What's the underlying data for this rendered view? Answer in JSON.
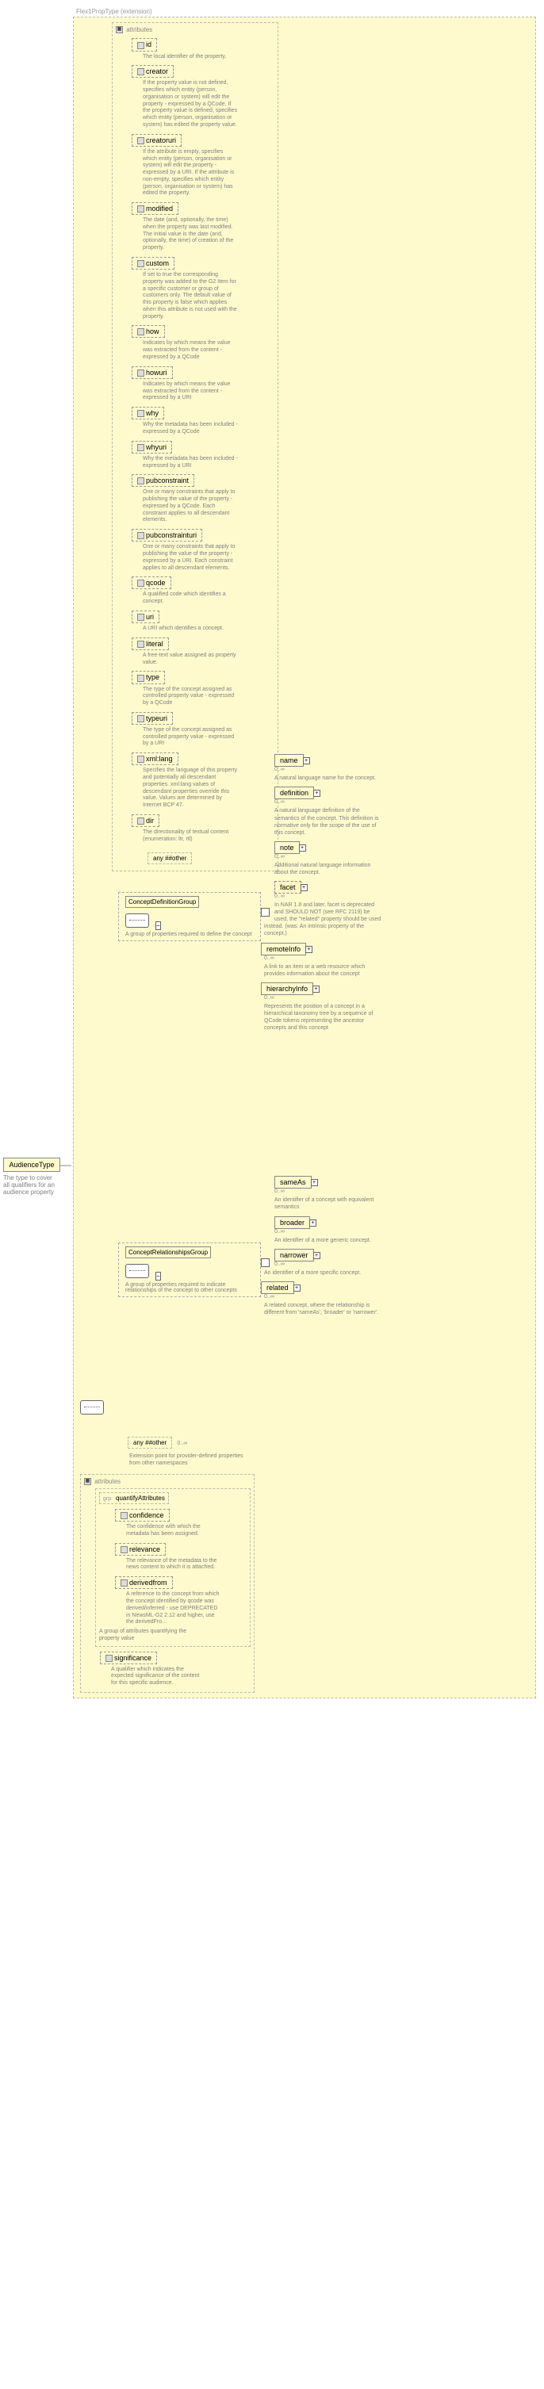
{
  "root": {
    "name": "AudienceType",
    "desc": "The type to cover all qualifiers for an audience property"
  },
  "extension": "Flex1PropType (extension)",
  "attrs_hdr": "attributes",
  "any": "any ##other",
  "flex_attrs": [
    {
      "n": "id",
      "d": "The local identifier of the property."
    },
    {
      "n": "creator",
      "d": "If the property value is not defined, specifies which entity (person, organisation or system) will edit the property - expressed by a QCode. If the property value is defined, specifies which entity (person, organisation or system) has edited the property value."
    },
    {
      "n": "creatoruri",
      "d": "If the attribute is empty, specifies which entity (person, organisation or system) will edit the property - expressed by a URI. If the attribute is non-empty, specifies which entity (person, organisation or system) has edited the property."
    },
    {
      "n": "modified",
      "d": "The date (and, optionally, the time) when the property was last modified. The initial value is the date (and, optionally, the time) of creation of the property."
    },
    {
      "n": "custom",
      "d": "If set to true the corresponding property was added to the G2 Item for a specific customer or group of customers only. The default value of this property is false which applies when this attribute is not used with the property."
    },
    {
      "n": "how",
      "d": "Indicates by which means the value was extracted from the content - expressed by a QCode"
    },
    {
      "n": "howuri",
      "d": "Indicates by which means the value was extracted from the content - expressed by a URI"
    },
    {
      "n": "why",
      "d": "Why the metadata has been included - expressed by a QCode"
    },
    {
      "n": "whyuri",
      "d": "Why the metadata has been included - expressed by a URI"
    },
    {
      "n": "pubconstraint",
      "d": "One or many constraints that apply to publishing the value of the property - expressed by a QCode. Each constraint applies to all descendant elements."
    },
    {
      "n": "pubconstrainturi",
      "d": "One or many constraints that apply to publishing the value of the property - expressed by a URI. Each constraint applies to all descendant elements."
    },
    {
      "n": "qcode",
      "d": "A qualified code which identifies a concept."
    },
    {
      "n": "uri",
      "d": "A URI which identifies a concept."
    },
    {
      "n": "literal",
      "d": "A free-text value assigned as property value."
    },
    {
      "n": "type",
      "d": "The type of the concept assigned as controlled property value - expressed by a QCode"
    },
    {
      "n": "typeuri",
      "d": "The type of the concept assigned as controlled property value - expressed by a URI"
    },
    {
      "n": "xml:lang",
      "d": "Specifies the language of this property and potentially all descendant properties. xml:lang values of descendant properties override this value. Values are determined by Internet BCP 47."
    },
    {
      "n": "dir",
      "d": "The directionality of textual content (enumeration: ltr, rtl)"
    }
  ],
  "cdg": {
    "title": "ConceptDefinitionGroup",
    "desc": "A group of properties required to define the concept"
  },
  "cdg_children": [
    {
      "n": "name",
      "card": "0..∞",
      "d": "A natural language name for the concept."
    },
    {
      "n": "definition",
      "card": "0..∞",
      "d": "A natural language definition of the semantics of the concept. This definition is normative only for the scope of the use of this concept."
    },
    {
      "n": "note",
      "card": "0..∞",
      "d": "Additional natural language information about the concept."
    },
    {
      "n": "facet",
      "card": "0..∞",
      "d": "In NAR 1.8 and later, facet is deprecated and SHOULD NOT (see RFC 2119) be used, the \"related\" property should be used instead. (was: An intrinsic property of the concept.)",
      "dashed": true,
      "stripe": true
    },
    {
      "n": "remoteInfo",
      "card": "0..∞",
      "d": "A link to an item or a web resource which provides information about the concept"
    },
    {
      "n": "hierarchyInfo",
      "card": "0..∞",
      "d": "Represents the position of a concept in a hierarchical taxonomy tree by a sequence of QCode tokens representing the ancestor concepts and this concept"
    }
  ],
  "crg": {
    "title": "ConceptRelationshipsGroup",
    "desc": "A group of properties required to indicate relationships of the concept to other concepts"
  },
  "crg_children": [
    {
      "n": "sameAs",
      "card": "0..∞",
      "d": "An identifier of a concept with equivalent semantics"
    },
    {
      "n": "broader",
      "card": "0..∞",
      "d": "An identifier of a more generic concept."
    },
    {
      "n": "narrower",
      "card": "0..∞",
      "d": "An identifier of a more specific concept."
    },
    {
      "n": "related",
      "card": "0..∞",
      "d": "A related concept, where the relationship is different from 'sameAs', 'broader' or 'narrower'."
    }
  ],
  "any2": {
    "label": "any ##other",
    "card": "0..∞",
    "desc": "Extension point for provider-defined properties from other namespaces"
  },
  "qattrs": {
    "title": "quantifyAttributes",
    "prefix": "grp: ",
    "items": [
      {
        "n": "confidence",
        "d": "The confidence with which the metadata has been assigned."
      },
      {
        "n": "relevance",
        "d": "The relevance of the metadata to the news content to which it is attached."
      },
      {
        "n": "derivedfrom",
        "d": "A reference to the concept from which the concept identified by qcode was derived/inferred - use DEPRECATED in NewsML-G2 2.12 and higher, use the derivedFro..."
      }
    ],
    "grp_desc": "A group of attributes quantifying the property value"
  },
  "sig": {
    "n": "significance",
    "d": "A qualifier which indicates the expected significance of the content for this specific audience."
  }
}
